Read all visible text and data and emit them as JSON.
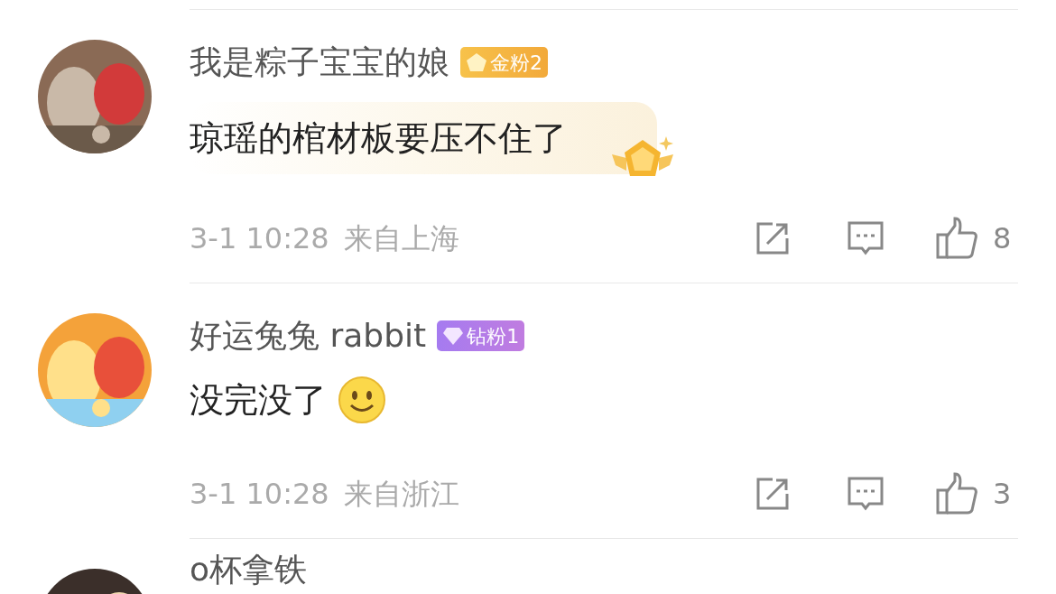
{
  "comments": [
    {
      "name": "我是粽子宝宝的娘",
      "badge": {
        "kind": "gold",
        "label": "金粉2"
      },
      "content": "琼瑶的棺材板要压不住了",
      "bubble": true,
      "emoji": false,
      "time": "3-1 10:28",
      "location": "来自上海",
      "likes": "8"
    },
    {
      "name": "好运兔兔 rabbit",
      "badge": {
        "kind": "diamond",
        "label": "钻粉1"
      },
      "content": "没完没了",
      "bubble": false,
      "emoji": true,
      "time": "3-1 10:28",
      "location": "来自浙江",
      "likes": "3"
    },
    {
      "name": "o杯拿铁"
    }
  ]
}
